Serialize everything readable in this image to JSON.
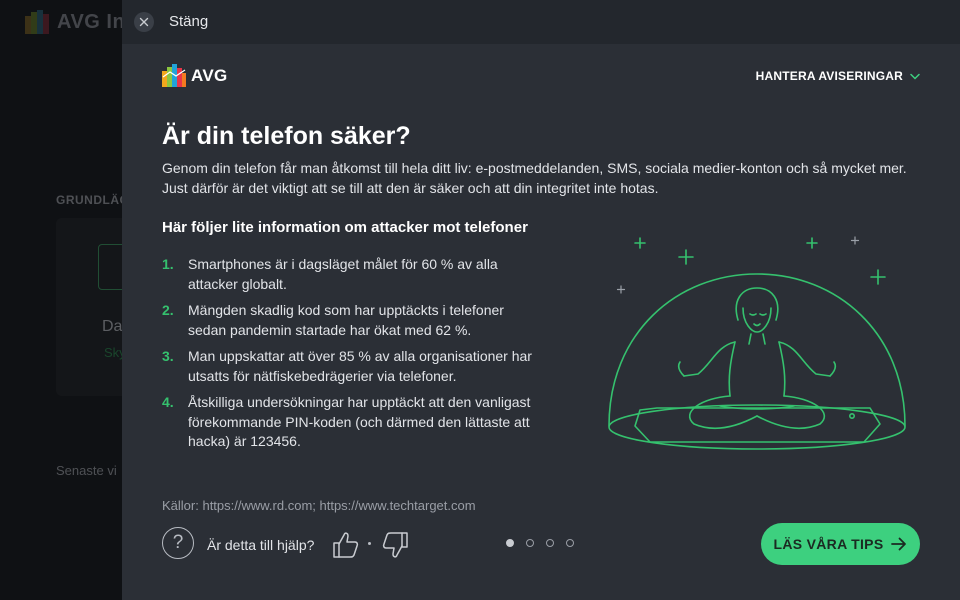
{
  "background": {
    "app_name": "AVG Inte",
    "section_label": "GRUNDLÄG",
    "card_title": "Da",
    "card_subtitle": "Sky",
    "recent_label": "Senaste vi"
  },
  "overlay": {
    "close_label": "Stäng",
    "logo_text": "AVG",
    "notifications_label": "HANTERA AVISERINGAR",
    "headline": "Är din telefon säker?",
    "intro": "Genom din telefon får man åtkomst till hela ditt liv: e-postmeddelanden, SMS, sociala medier-konton och så mycket mer. Just därför är det viktigt att se till att den är säker och att din integritet inte hotas.",
    "sub_headline": "Här följer lite information om attacker mot telefoner",
    "facts": [
      {
        "num": "1.",
        "text": "Smartphones är i dagsläget målet för 60 % av alla attacker globalt."
      },
      {
        "num": "2.",
        "text": "Mängden skadlig kod som har upptäckts i telefoner sedan pandemin startade har ökat med 62 %."
      },
      {
        "num": "3.",
        "text": "Man uppskattar att över 85 % av alla organisationer har utsatts för nätfiskebedrägerier via telefoner."
      },
      {
        "num": "4.",
        "text": "Åtskilliga undersökningar har upptäckt att den vanligast förekommande PIN-koden (och därmed den lättaste att hacka) är 123456."
      }
    ],
    "sources": "Källor: https://www.rd.com; https://www.techtarget.com",
    "help_question": "Är detta till hjälp?",
    "help_icon_glyph": "?",
    "pager": {
      "total": 4,
      "current": 1
    },
    "cta_label": "LÄS VÅRA TIPS"
  },
  "colors": {
    "accent_green": "#3dd07f",
    "number_green": "#35c16e",
    "panel_bg": "#2b2f36",
    "illustration_stroke": "#35c16e"
  },
  "icons": {
    "close": "close-icon",
    "chevron": "chevron-down-icon",
    "help": "question-circle-icon",
    "thumb_up": "thumbs-up-icon",
    "thumb_down": "thumbs-down-icon",
    "arrow": "arrow-right-icon",
    "logo": "avg-logo-icon"
  }
}
